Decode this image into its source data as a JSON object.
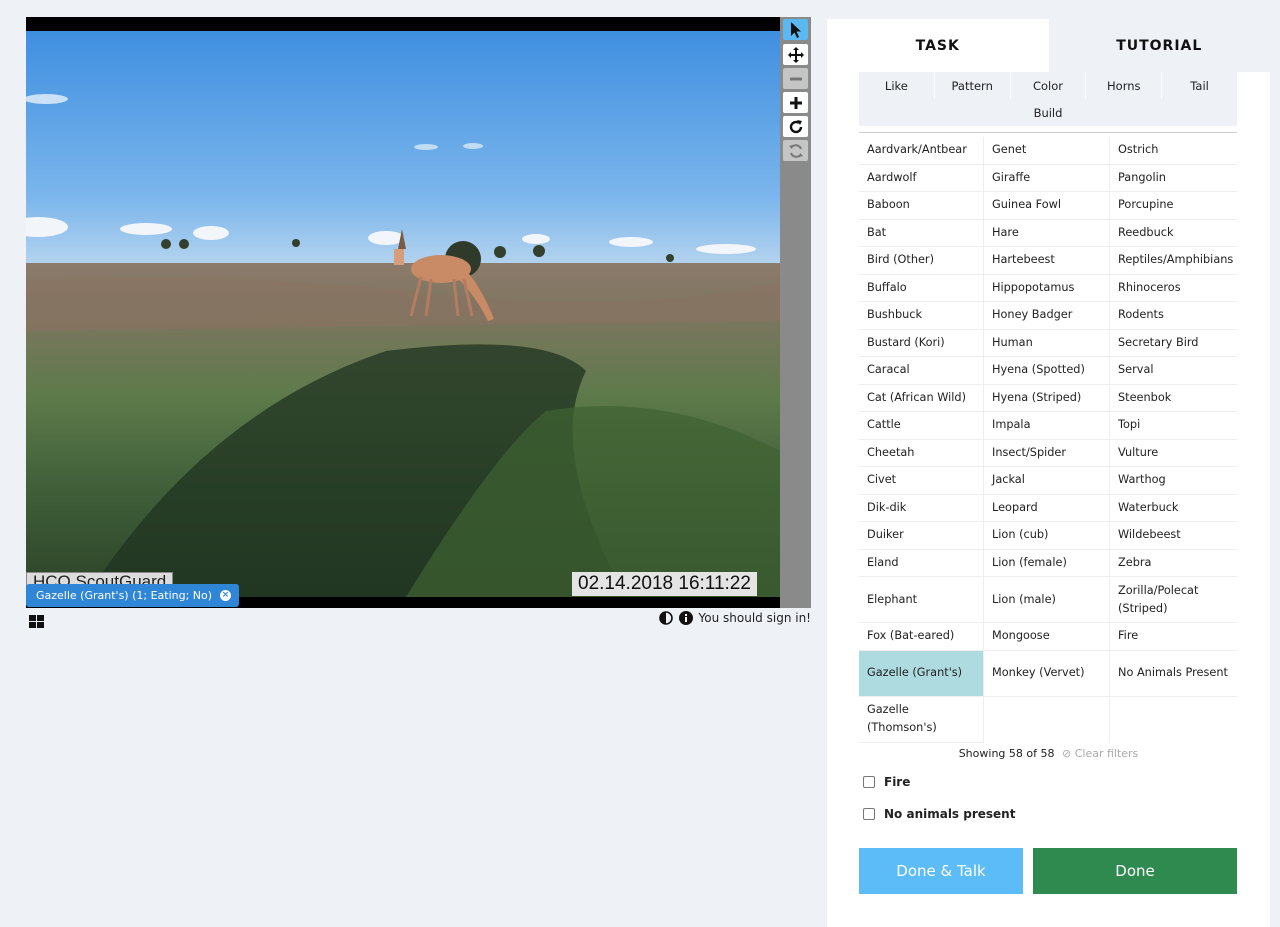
{
  "viewer": {
    "camera_label": "HCO ScoutGuard",
    "timestamp": "02.14.2018 16:11:22",
    "tag_text": "Gazelle (Grant's) (1; Eating; No)",
    "sign_in_text": "You should sign in!",
    "tools": [
      "pointer-icon",
      "move-icon",
      "zoom-out-icon",
      "zoom-in-icon",
      "rotate-icon",
      "reset-icon"
    ]
  },
  "tabs": [
    {
      "label": "TASK",
      "active": true
    },
    {
      "label": "TUTORIAL",
      "active": false
    }
  ],
  "filters": [
    "Like",
    "Pattern",
    "Color",
    "Horns",
    "Tail"
  ],
  "filter_extra": "Build",
  "choices": [
    "Aardvark/Antbear",
    "Genet",
    "Ostrich",
    "Aardwolf",
    "Giraffe",
    "Pangolin",
    "Baboon",
    "Guinea Fowl",
    "Porcupine",
    "Bat",
    "Hare",
    "Reedbuck",
    "Bird (Other)",
    "Hartebeest",
    "Reptiles/Amphibians",
    "Buffalo",
    "Hippopotamus",
    "Rhinoceros",
    "Bushbuck",
    "Honey Badger",
    "Rodents",
    "Bustard (Kori)",
    "Human",
    "Secretary Bird",
    "Caracal",
    "Hyena (Spotted)",
    "Serval",
    "Cat (African Wild)",
    "Hyena (Striped)",
    "Steenbok",
    "Cattle",
    "Impala",
    "Topi",
    "Cheetah",
    "Insect/Spider",
    "Vulture",
    "Civet",
    "Jackal",
    "Warthog",
    "Dik-dik",
    "Leopard",
    "Waterbuck",
    "Duiker",
    "Lion (cub)",
    "Wildebeest",
    "Eland",
    "Lion (female)",
    "Zebra",
    "Elephant",
    "Lion (male)",
    "Zorilla/Polecat (Striped)",
    "Fox (Bat-eared)",
    "Mongoose",
    "Fire",
    "Gazelle (Grant's)",
    "Monkey (Vervet)",
    "No Animals Present",
    "Gazelle (Thomson's)",
    "",
    ""
  ],
  "selected_choice": "Gazelle (Grant's)",
  "showing_text": "Showing 58 of 58",
  "clear_filters": "Clear filters",
  "checkboxes": [
    "Fire",
    "No animals present"
  ],
  "buttons": {
    "done_talk": "Done & Talk",
    "done": "Done"
  },
  "colors": {
    "accent": "#5bbcf8",
    "done": "#2e8a4f",
    "selected": "#addbe0",
    "tag": "#2f86d6"
  }
}
